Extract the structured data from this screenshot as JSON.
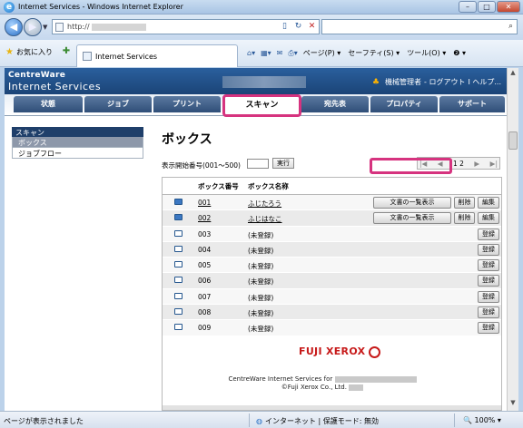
{
  "window": {
    "title": "Internet Services - Windows Internet Explorer",
    "minimize": "–",
    "maximize": "□",
    "close": "✕"
  },
  "addressbar": {
    "url_prefix": "http://",
    "back": "◀",
    "forward": "▶"
  },
  "favorites": {
    "label": "お気に入り",
    "tab_title": "Internet Services"
  },
  "commandbar": {
    "items": [
      "ページ(P) ▾",
      "セーフティ(S) ▾",
      "ツール(O) ▾",
      "❷ ▾"
    ]
  },
  "header": {
    "brand_line1": "CentreWare",
    "brand_line2": "Internet Services",
    "admin_label": "機械管理者",
    "logout": "- ログアウト",
    "help": "I ヘルプ..."
  },
  "tabs": [
    "状態",
    "ジョブ",
    "プリント",
    "スキャン",
    "宛先表",
    "プロパティ",
    "サポート"
  ],
  "active_tab": "スキャン",
  "sidebar": {
    "section": "スキャン",
    "items": [
      "ボックス",
      "ジョブフロー"
    ]
  },
  "main": {
    "title": "ボックス",
    "start_label": "表示開始番号(001〜500)",
    "exec_button": "実行",
    "pager": {
      "first": "|◀",
      "prev": "◀",
      "page": "1 2",
      "next": "▶",
      "last": "▶|"
    },
    "columns": [
      "ボックス番号",
      "ボックス名称"
    ],
    "rows": [
      {
        "num": "001",
        "name": "ふじたろう",
        "registered": true
      },
      {
        "num": "002",
        "name": "ふじはなこ",
        "registered": true
      },
      {
        "num": "003",
        "name": "(未登録)",
        "registered": false
      },
      {
        "num": "004",
        "name": "(未登録)",
        "registered": false
      },
      {
        "num": "005",
        "name": "(未登録)",
        "registered": false
      },
      {
        "num": "006",
        "name": "(未登録)",
        "registered": false
      },
      {
        "num": "007",
        "name": "(未登録)",
        "registered": false
      },
      {
        "num": "008",
        "name": "(未登録)",
        "registered": false
      },
      {
        "num": "009",
        "name": "(未登録)",
        "registered": false
      }
    ],
    "btn_list": "文書の一覧表示",
    "btn_delete": "削除",
    "btn_edit": "編集",
    "btn_register": "登録"
  },
  "footer": {
    "logo": "FUJI XEROX",
    "line1": "CentreWare Internet Services for",
    "line2": "©Fuji Xerox Co., Ltd."
  },
  "status": {
    "message": "ページが表示されました",
    "zone": "インターネット | 保護モード: 無効",
    "zoom": "100%"
  },
  "colors": {
    "highlight": "#d6337f",
    "header_blue": "#1b4477",
    "logo_red": "#c71a1a"
  }
}
